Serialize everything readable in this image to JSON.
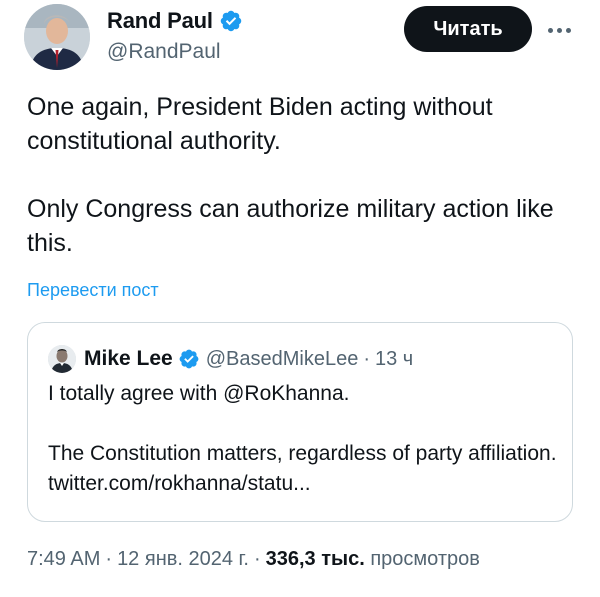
{
  "author": {
    "display_name": "Rand Paul",
    "handle": "@RandPaul",
    "verified_icon": "verified-badge-icon",
    "verified_color": "#1d9bf0"
  },
  "follow_button": {
    "label": "Читать"
  },
  "more_button": {
    "icon": "more-options-icon"
  },
  "tweet": {
    "paragraphs": [
      "One again, President Biden acting without constitutional authority.",
      "Only Congress can authorize military action like this."
    ],
    "translate_link": "Перевести пост"
  },
  "quoted_tweet": {
    "display_name": "Mike Lee",
    "handle": "@BasedMikeLee",
    "separator": "·",
    "time": "13 ч",
    "paragraphs": [
      "I totally agree with @RoKhanna.",
      "The Constitution matters, regardless of party affiliation. twitter.com/rokhanna/statu..."
    ]
  },
  "meta": {
    "time": "7:49 AM",
    "separator": "·",
    "date": "12 янв. 2024 г.",
    "views_count": "336,3 тыс.",
    "views_label": "просмотров"
  },
  "colors": {
    "accent": "#1d9bf0",
    "text_primary": "#0f1419",
    "text_secondary": "#536471",
    "button_bg": "#0f1419",
    "border": "#cfd9de"
  }
}
